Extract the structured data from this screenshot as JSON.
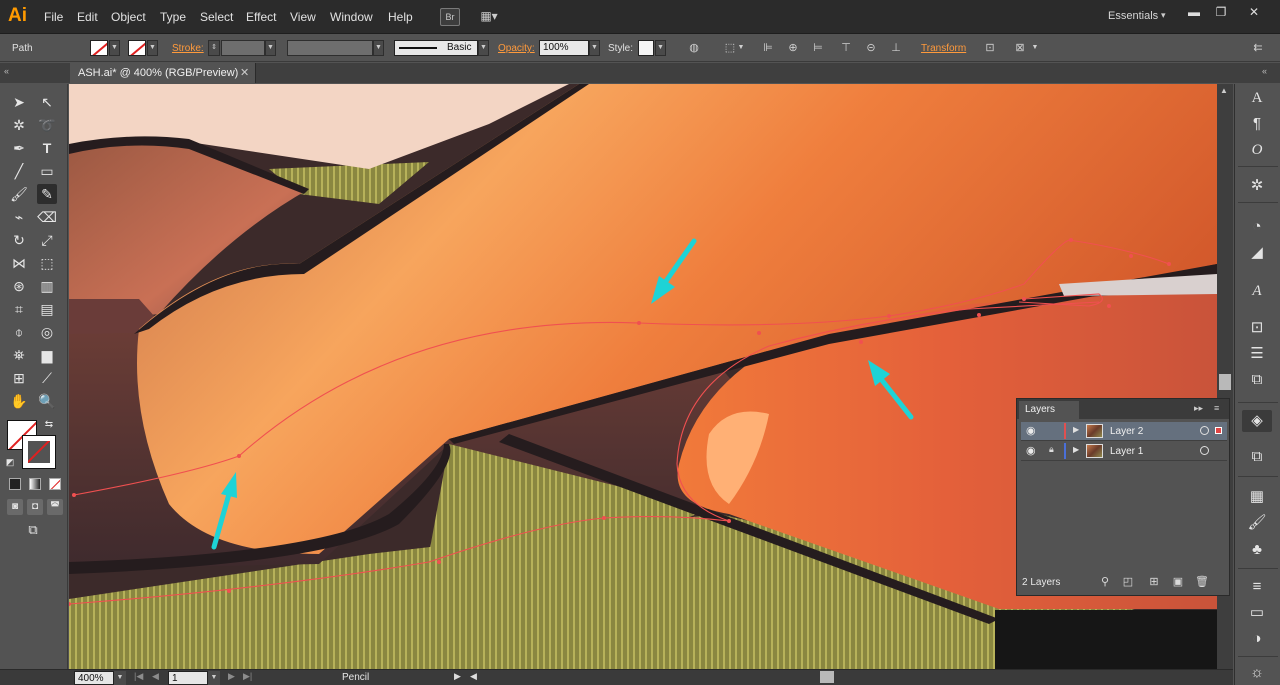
{
  "app": {
    "logo": "Ai"
  },
  "menu": [
    "File",
    "Edit",
    "Object",
    "Type",
    "Select",
    "Effect",
    "View",
    "Window",
    "Help"
  ],
  "menubar_icons": {
    "bridge": "Br",
    "arrange": "▦▾"
  },
  "workspace": {
    "label": "Essentials",
    "caret": "▾"
  },
  "window_controls": {
    "minimize": "▬",
    "restore": "❐",
    "close": "✕"
  },
  "control_bar": {
    "selection_label": "Path",
    "stroke_label": "Stroke:",
    "brush_label": "Basic",
    "opacity_label": "Opacity:",
    "opacity_value": "100%",
    "style_label": "Style:",
    "transform_label": "Transform"
  },
  "document": {
    "tab_title": "ASH.ai* @ 400% (RGB/Preview)",
    "close": "✕"
  },
  "collapse": {
    "left": "«",
    "right": "«"
  },
  "status_bar": {
    "zoom": "400%",
    "artboard": "1",
    "current_tool": "Pencil",
    "nav_first": "|◀",
    "nav_prev": "◀",
    "nav_next": "▶",
    "nav_last": "▶|",
    "hscroll_left": "◀",
    "status_arrow": "▶"
  },
  "layers_panel": {
    "title": "Layers",
    "collapse": "▸▸",
    "menu": "≡",
    "count": "2 Layers",
    "layers": [
      {
        "name": "Layer 2",
        "color": "#e05050",
        "selected": true,
        "locked": false,
        "visible": true
      },
      {
        "name": "Layer 1",
        "color": "#4a6fd8",
        "selected": false,
        "locked": true,
        "visible": true
      }
    ]
  },
  "icons": {
    "eye": "◉",
    "lock": "🔒",
    "expand": "▶",
    "scroll_up": "▲"
  },
  "colors": {
    "accent_orange": "#ff9a00",
    "link_orange": "#ff9a3c",
    "arrow_cyan": "#1ed3d6",
    "path_red": "#f05050",
    "skin_light": "#f3843f",
    "skin_dark": "#4a2d2e",
    "grass": "#8a8a44"
  }
}
